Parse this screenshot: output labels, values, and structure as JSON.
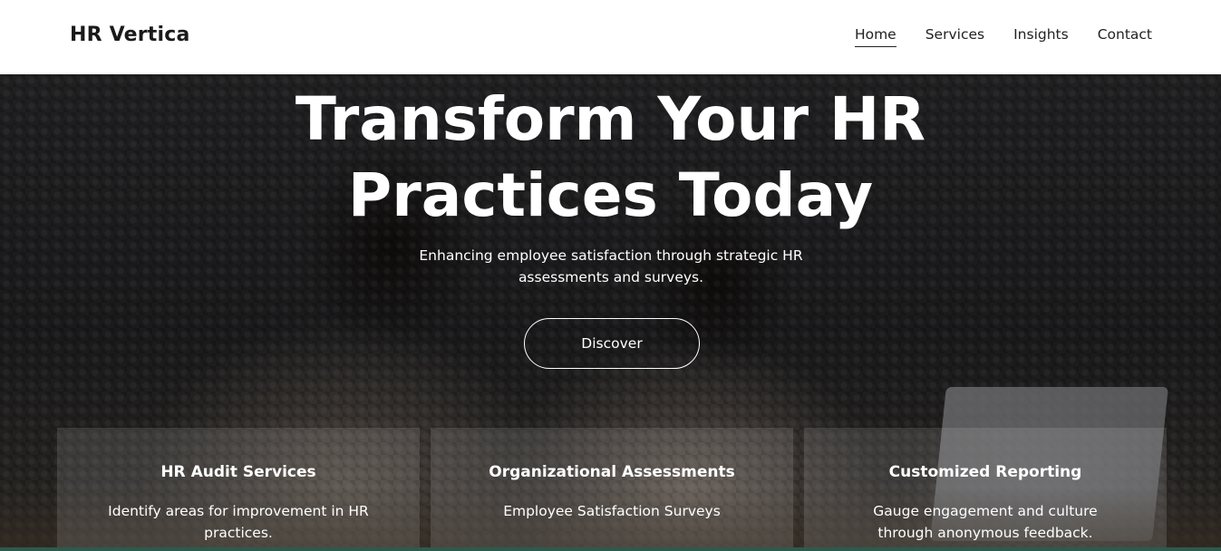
{
  "brand": {
    "name": "HR Vertica"
  },
  "nav": {
    "items": [
      {
        "label": "Home",
        "active": true
      },
      {
        "label": "Services",
        "active": false
      },
      {
        "label": "Insights",
        "active": false
      },
      {
        "label": "Contact",
        "active": false
      }
    ]
  },
  "hero": {
    "title": "Transform Your HR\nPractices Today",
    "subtitle": "Enhancing employee satisfaction through strategic HR assessments and surveys.",
    "cta_label": "Discover"
  },
  "cards": [
    {
      "title": "HR Audit Services",
      "text": "Identify areas for improvement in HR practices."
    },
    {
      "title": "Organizational Assessments",
      "text": "Employee Satisfaction Surveys"
    },
    {
      "title": "Customized Reporting",
      "text": "Gauge engagement and culture through anonymous feedback."
    }
  ],
  "colors": {
    "header_bg": "#ffffff",
    "text_dark": "#1a1a1a",
    "hero_text": "#ffffff"
  }
}
